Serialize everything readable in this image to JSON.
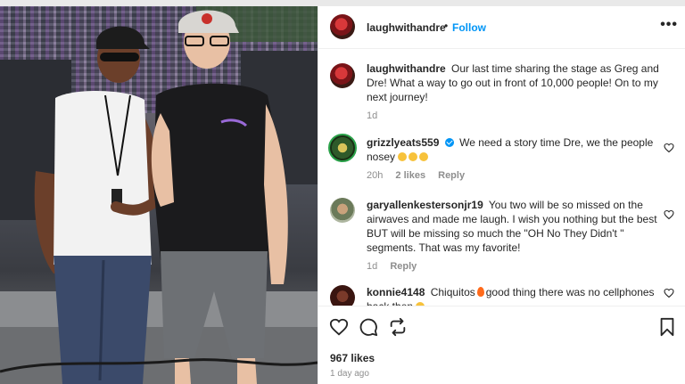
{
  "post": {
    "username": "laughwithandre",
    "separator": "•",
    "follow_label": "Follow",
    "more_label": "•••",
    "photo_alt_icons": [
      "cap-logo-raiders",
      "cap-logo-49ers"
    ]
  },
  "caption": {
    "username": "laughwithandre",
    "text": "Our last time sharing the stage as Greg and Dre! What a way to go out in front of 10,000 people! On to my next journey!",
    "time": "1d"
  },
  "comments": [
    {
      "username": "grizzlyeats559",
      "text": "We need a story time Dre, we the people nosey",
      "time": "20h",
      "likes": "2 likes",
      "reply": "Reply"
    },
    {
      "username": "garyallenkestersonjr19",
      "text": "You two will be so missed on the airwaves and made me laugh. I wish you nothing but the best BUT will be missing so much the \"OH No They Didn't \" segments. That was my favorite!",
      "time": "1d",
      "reply": "Reply"
    },
    {
      "username": "konnie4148",
      "text_a": "Chiquitos",
      "text_b": "good thing there was no cellphones back then"
    }
  ],
  "footer": {
    "likes": "967 likes",
    "time_ago": "1 day ago"
  },
  "colors": {
    "accent": "#0095f6",
    "text": "#262626",
    "muted": "#8e8e8e"
  }
}
